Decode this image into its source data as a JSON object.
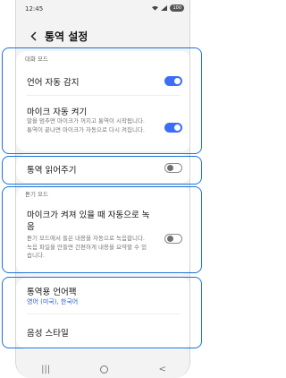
{
  "status_bar": {
    "time": "12:45",
    "battery": "100"
  },
  "header": {
    "title": "통역 설정"
  },
  "conversation_mode": {
    "section_label": "대화 모드",
    "auto_detect_language": {
      "title": "언어 자동 감지",
      "toggle": "on"
    },
    "auto_mic": {
      "title": "마이크 자동 켜기",
      "description": "말을 멈추면 마이크가 꺼지고 통역이 시작됩니다. 통역이 끝나면 마이크가 자동으로 다시 켜집니다.",
      "toggle": "on"
    }
  },
  "read_aloud": {
    "title": "통역 읽어주기",
    "toggle": "off"
  },
  "listening_mode": {
    "section_label": "듣기 모드",
    "auto_record": {
      "title": "마이크가 켜져 있을 때 자동으로 녹음",
      "description": "듣기 모드에서 들은 내용을 자동으로 녹음합니다. 녹음 파일을 만들면 간편하게 내용을 요약할 수 있습니다.",
      "toggle": "off"
    }
  },
  "language_pack": {
    "title": "통역용 언어팩",
    "subtitle": "영어 (미국), 한국어"
  },
  "voice_style": {
    "title": "음성 스타일"
  },
  "nav": {
    "recents": "|||",
    "back": "<"
  },
  "colors": {
    "accent": "#3b6ef5",
    "highlight": "#1a73d8"
  }
}
